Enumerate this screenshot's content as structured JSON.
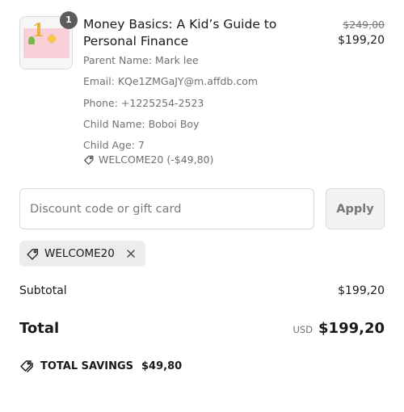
{
  "product": {
    "quantity_badge": "1",
    "title": "Money Basics: A Kid’s Guide to Personal Finance",
    "price_original": "$249,00",
    "price_current": "$199,20",
    "details": [
      "Parent Name: Mark lee",
      "Email: KQe1ZMGaJY@m.affdb.com",
      "Phone: +1225254-2523",
      "Child Name: Boboi Boy",
      "Child Age: 7"
    ],
    "discount_applied": "WELCOME20 (-$49,80)",
    "thumbnail_text": "1"
  },
  "discount": {
    "placeholder": "Discount code or gift card",
    "apply_label": "Apply",
    "applied_code": "WELCOME20"
  },
  "summary": {
    "subtotal_label": "Subtotal",
    "subtotal_value": "$199,20",
    "total_label": "Total",
    "currency": "USD",
    "total_value": "$199,20",
    "savings_label": "TOTAL SAVINGS",
    "savings_value": "$49,80"
  },
  "icons": {
    "tag": "tag-icon",
    "close": "close-icon",
    "savings_tag": "tags-icon"
  }
}
